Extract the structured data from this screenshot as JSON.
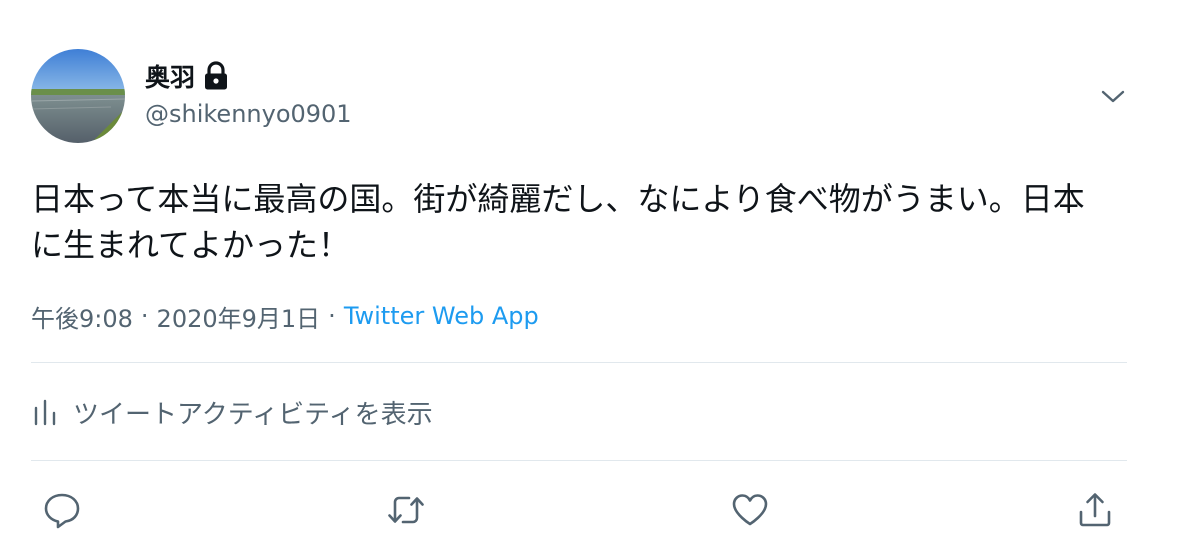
{
  "user": {
    "display_name": "奥羽",
    "handle": "@shikennyo0901",
    "protected_icon": "lock-icon",
    "avatar": "landscape-avatar"
  },
  "menu_icon": "chevron-down-icon",
  "tweet": {
    "text": "日本って本当に最高の国。街が綺麗だし、なにより食べ物がうまい。日本に生まれてよかった！"
  },
  "meta": {
    "time": "午後9:08",
    "date": "2020年9月1日",
    "separator": "·",
    "source": "Twitter Web App"
  },
  "activity": {
    "label": "ツイートアクティビティを表示",
    "icon": "bar-chart-icon"
  },
  "actions": [
    {
      "name": "reply",
      "icon": "reply-icon"
    },
    {
      "name": "retweet",
      "icon": "retweet-icon"
    },
    {
      "name": "like",
      "icon": "heart-icon"
    },
    {
      "name": "share",
      "icon": "share-icon"
    }
  ],
  "colors": {
    "text_primary": "#0f1419",
    "text_secondary": "#536471",
    "link": "#1d9bf0",
    "divider": "#e1e8ed"
  }
}
